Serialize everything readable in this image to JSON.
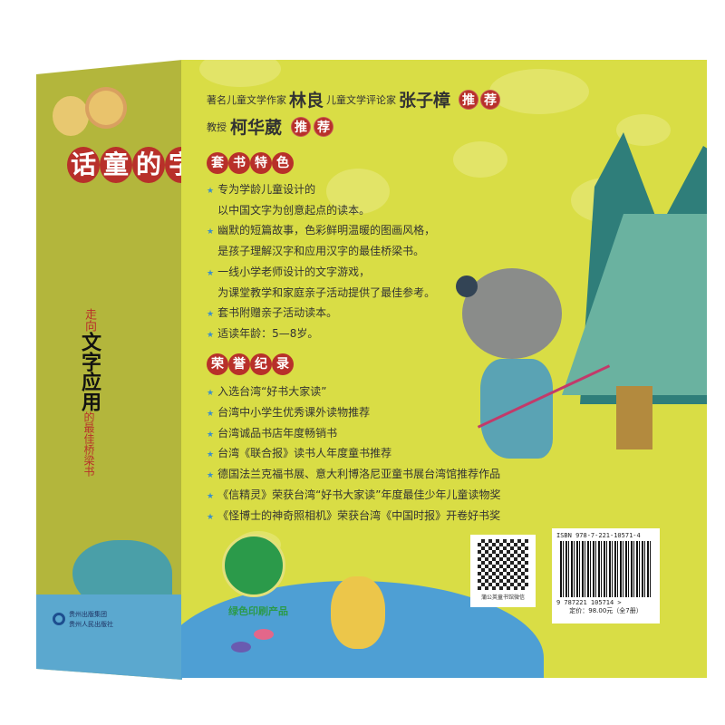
{
  "spine": {
    "title_chars": [
      "字",
      "的",
      "童",
      "话"
    ],
    "subtitle_red_top": "走向",
    "subtitle_black": "文字应用",
    "subtitle_red_bottom": "的最佳桥梁书",
    "publisher_line1": "贵州出版集团",
    "publisher_line2": "贵州人民出版社"
  },
  "header": {
    "line1_label1": "著名儿童文学作家",
    "line1_name1": "林良",
    "line1_label2": "儿童文学评论家",
    "line1_name2": "张子樟",
    "line2_label": "教授",
    "line2_name": "柯华葳",
    "recommend_chars": [
      "推",
      "荐"
    ]
  },
  "features": {
    "heading_chars": [
      "套",
      "书",
      "特",
      "色"
    ],
    "items": [
      {
        "star": true,
        "text": "专为学龄儿童设计的"
      },
      {
        "star": false,
        "text": "以中国文字为创意起点的读本。"
      },
      {
        "star": true,
        "text": "幽默的短篇故事，色彩鲜明温暖的图画风格，"
      },
      {
        "star": false,
        "text": "是孩子理解汉字和应用汉字的最佳桥梁书。"
      },
      {
        "star": true,
        "text": "一线小学老师设计的文字游戏，"
      },
      {
        "star": false,
        "text": "为课堂教学和家庭亲子活动提供了最佳参考。"
      },
      {
        "star": true,
        "text": "套书附赠亲子活动读本。"
      },
      {
        "star": true,
        "text": "适读年龄：5—8岁。"
      }
    ]
  },
  "honors": {
    "heading_chars": [
      "荣",
      "誉",
      "纪",
      "录"
    ],
    "items": [
      "入选台湾“好书大家读”",
      "台湾中小学生优秀课外读物推荐",
      "台湾诚品书店年度畅销书",
      "台湾《联合报》读书人年度童书推荐",
      "德国法兰克福书展、意大利博洛尼亚童书展台湾馆推荐作品",
      "《信精灵》荣获台湾“好书大家读”年度最佳少年儿童读物奖",
      "《怪博士的神奇照相机》荣获台湾《中国时报》开卷好书奖"
    ]
  },
  "green_label": "绿色印刷产品",
  "qr_caption": "蒲公英童书馆微信",
  "isbn": {
    "label": "ISBN 978-7-221-10571-4",
    "digits": "9 787221 105714 >",
    "price": "定价：98.00元（全7册）"
  },
  "colors": {
    "front": "#d9dd45",
    "spine": "#b3b63c",
    "badge": "#b8302a",
    "star": "#3b8fc8"
  }
}
